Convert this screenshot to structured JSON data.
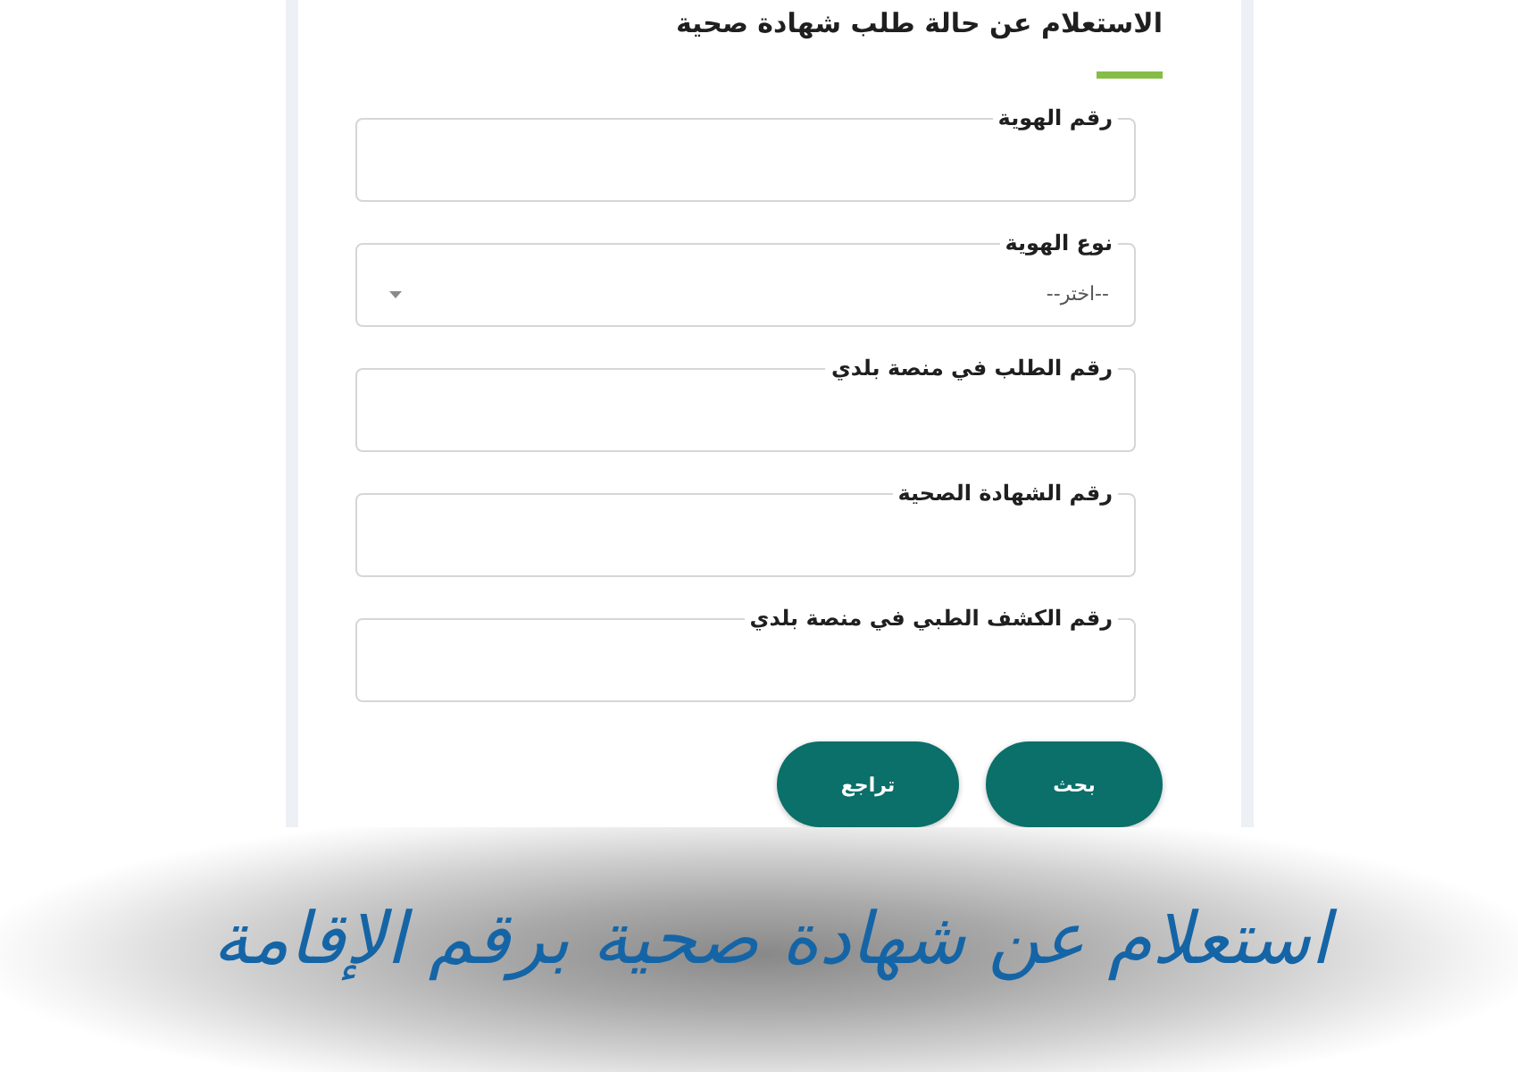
{
  "form": {
    "title": "الاستعلام عن حالة طلب شهادة صحية",
    "fields": [
      {
        "kind": "text",
        "label": "رقم الهوية"
      },
      {
        "kind": "select",
        "label": "نوع الهوية",
        "placeholder": "--اختر--"
      },
      {
        "kind": "text",
        "label": "رقم الطلب في منصة بلدي"
      },
      {
        "kind": "text",
        "label": "رقم الشهادة الصحية"
      },
      {
        "kind": "text",
        "label": "رقم الكشف الطبي في منصة بلدي"
      }
    ],
    "buttons": [
      {
        "kind": "search",
        "label": "بحث"
      },
      {
        "kind": "reset",
        "label": "تراجع"
      }
    ]
  },
  "banner": {
    "caption": "استعلام عن شهادة صحية برقم الإقامة"
  }
}
